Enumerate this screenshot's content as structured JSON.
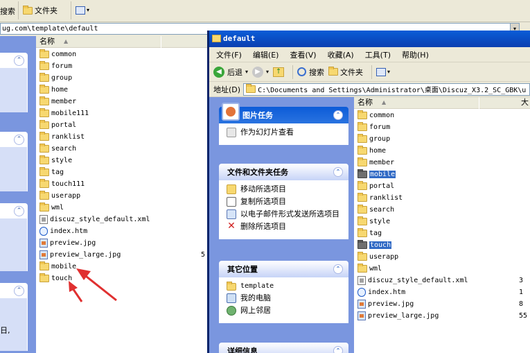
{
  "back": {
    "toolbar": {
      "search": "搜索",
      "folders": "文件夹"
    },
    "address": "ug.com\\template\\default",
    "list_header": "名称",
    "items": [
      {
        "name": "common",
        "type": "folder"
      },
      {
        "name": "forum",
        "type": "folder"
      },
      {
        "name": "group",
        "type": "folder"
      },
      {
        "name": "home",
        "type": "folder"
      },
      {
        "name": "member",
        "type": "folder"
      },
      {
        "name": "mobile111",
        "type": "folder"
      },
      {
        "name": "portal",
        "type": "folder"
      },
      {
        "name": "ranklist",
        "type": "folder"
      },
      {
        "name": "search",
        "type": "folder"
      },
      {
        "name": "style",
        "type": "folder"
      },
      {
        "name": "tag",
        "type": "folder"
      },
      {
        "name": "touch111",
        "type": "folder"
      },
      {
        "name": "userapp",
        "type": "folder"
      },
      {
        "name": "wml",
        "type": "folder"
      },
      {
        "name": "discuz_style_default.xml",
        "type": "xml"
      },
      {
        "name": "index.htm",
        "type": "htm"
      },
      {
        "name": "preview.jpg",
        "type": "img"
      },
      {
        "name": "preview_large.jpg",
        "type": "img",
        "size": "5"
      },
      {
        "name": "mobile",
        "type": "folder"
      },
      {
        "name": "touch",
        "type": "folder"
      }
    ],
    "left_fragment": "日,"
  },
  "front": {
    "title": "default",
    "menu": [
      "文件(F)",
      "编辑(E)",
      "查看(V)",
      "收藏(A)",
      "工具(T)",
      "帮助(H)"
    ],
    "toolbar": {
      "back": "后退",
      "search": "搜索",
      "folders": "文件夹"
    },
    "address_label": "地址(D)",
    "address": "C:\\Documents and Settings\\Administrator\\桌面\\Discuz_X3.2_SC_GBK\\u",
    "list_header": "名称",
    "list_header_2": "大",
    "picture_tasks": {
      "title": "图片任务",
      "items": [
        "作为幻灯片查看"
      ]
    },
    "file_tasks": {
      "title": "文件和文件夹任务",
      "items": [
        "移动所选项目",
        "复制所选项目",
        "以电子邮件形式发送所选项目",
        "删除所选项目"
      ]
    },
    "other_places": {
      "title": "其它位置",
      "items": [
        "template",
        "我的电脑",
        "网上邻居"
      ]
    },
    "details": {
      "title": "详细信息"
    },
    "items": [
      {
        "name": "common",
        "type": "folder"
      },
      {
        "name": "forum",
        "type": "folder"
      },
      {
        "name": "group",
        "type": "folder"
      },
      {
        "name": "home",
        "type": "folder"
      },
      {
        "name": "member",
        "type": "folder"
      },
      {
        "name": "mobile",
        "type": "folder",
        "selected": true
      },
      {
        "name": "portal",
        "type": "folder"
      },
      {
        "name": "ranklist",
        "type": "folder"
      },
      {
        "name": "search",
        "type": "folder"
      },
      {
        "name": "style",
        "type": "folder"
      },
      {
        "name": "tag",
        "type": "folder"
      },
      {
        "name": "touch",
        "type": "folder",
        "selected": true
      },
      {
        "name": "userapp",
        "type": "folder"
      },
      {
        "name": "wml",
        "type": "folder"
      },
      {
        "name": "discuz_style_default.xml",
        "type": "xml",
        "size": "3"
      },
      {
        "name": "index.htm",
        "type": "htm",
        "size": "1"
      },
      {
        "name": "preview.jpg",
        "type": "img",
        "size": "8"
      },
      {
        "name": "preview_large.jpg",
        "type": "img",
        "size": "55"
      }
    ]
  },
  "colors": {
    "selection": "#316ac5",
    "titlebar": "#0a5dd8",
    "taskpane": "#7a96df",
    "arrow": "#e03030"
  }
}
